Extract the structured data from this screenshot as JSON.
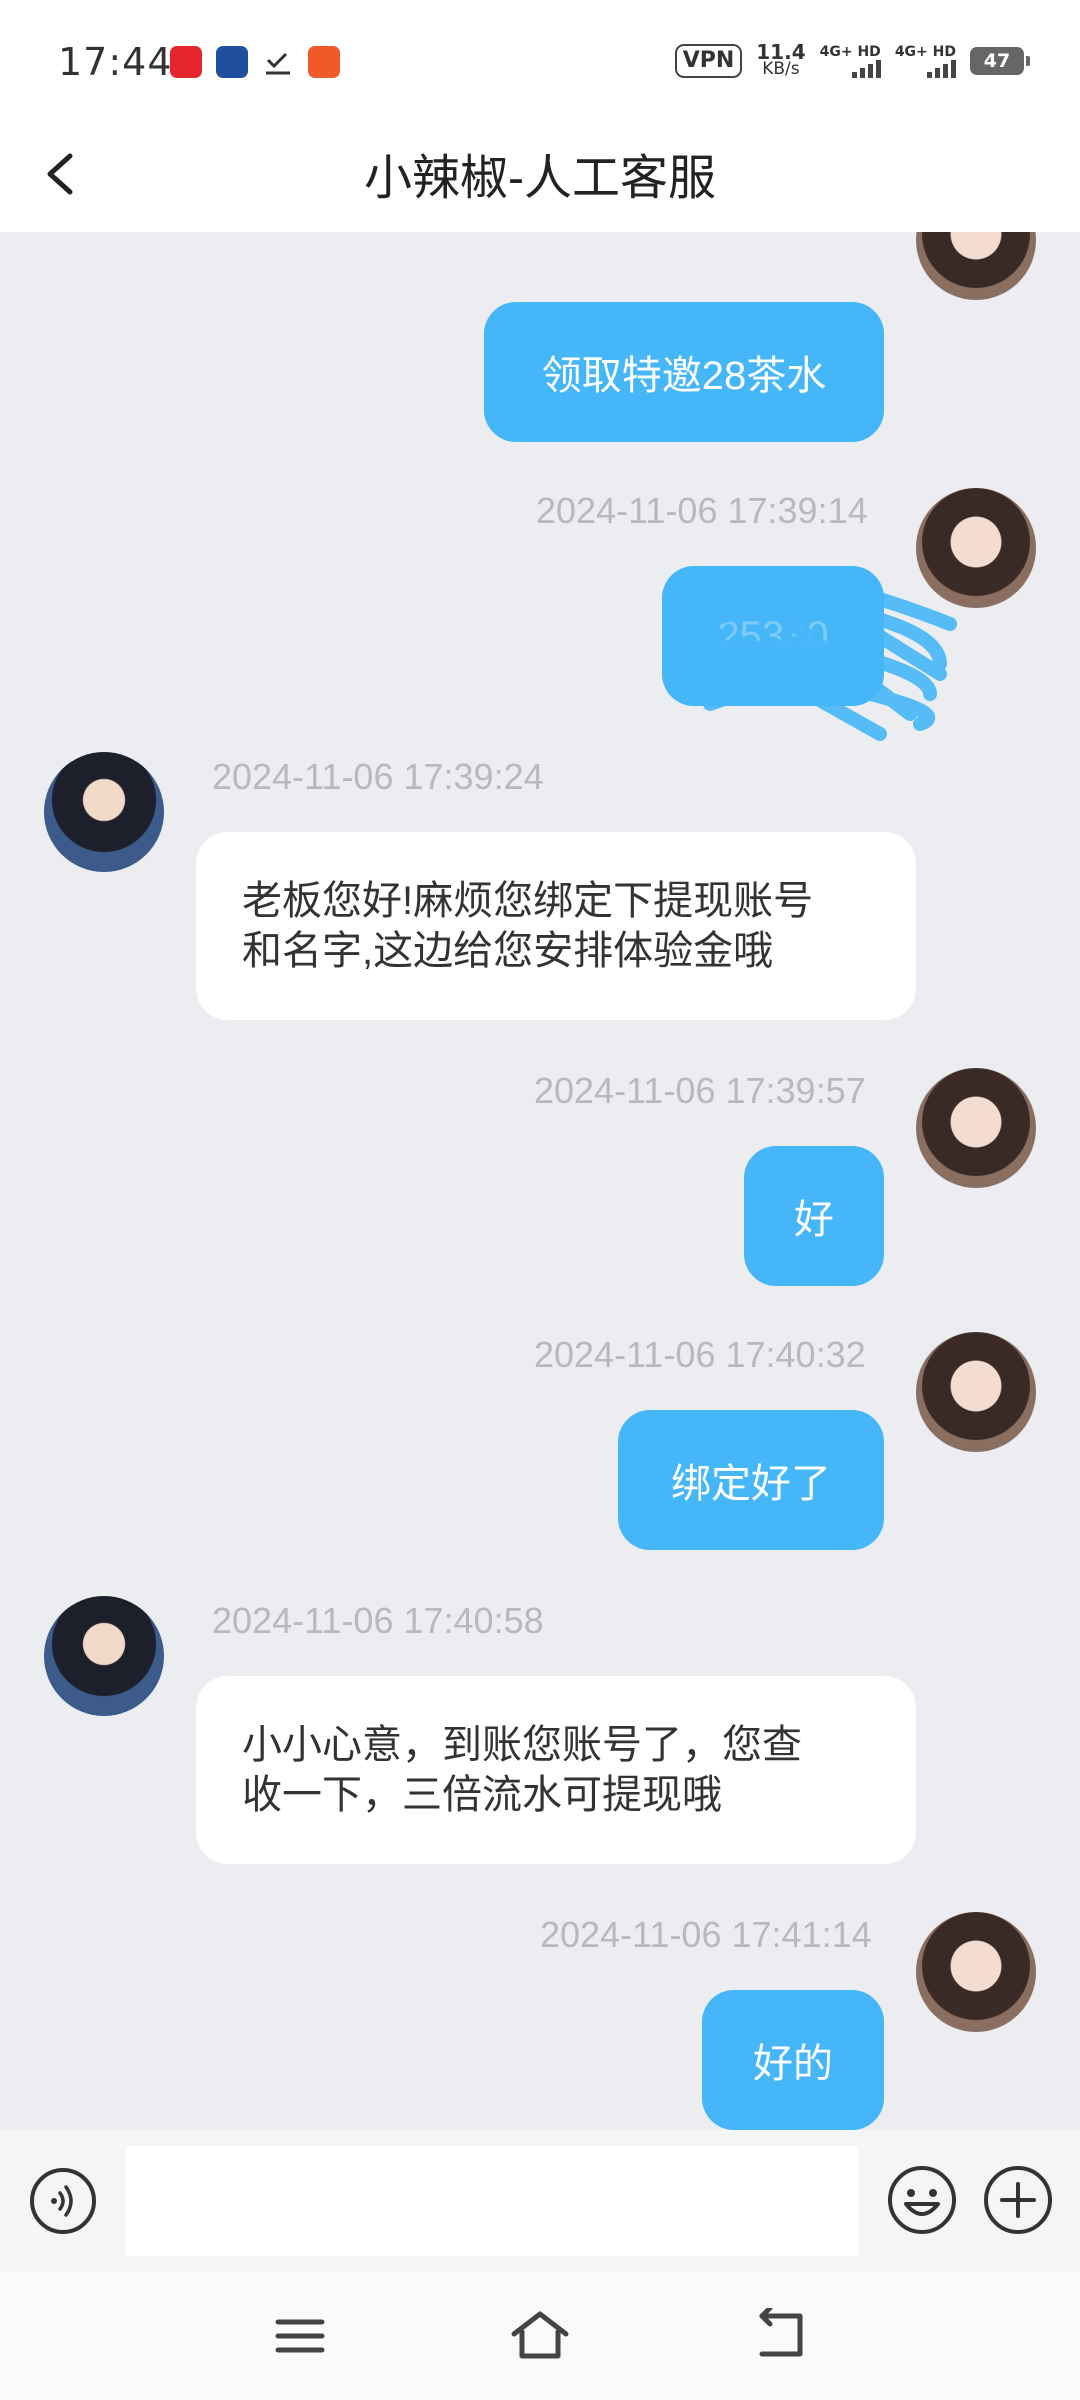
{
  "status_bar": {
    "time": "17:44",
    "vpn": "VPN",
    "speed_value": "11.4",
    "speed_unit": "KB/s",
    "sim1": "4G+ HD",
    "sim2": "4G+ HD",
    "battery": "47"
  },
  "header": {
    "title": "小辣椒-人工客服"
  },
  "messages": [
    {
      "side": "out",
      "text": "领取特邀28茶水"
    },
    {
      "side": "out",
      "time": "2024-11-06 17:39:14",
      "text": "25330"
    },
    {
      "side": "in",
      "time": "2024-11-06 17:39:24",
      "text_line1": "老板您好!麻烦您绑定下提现账号",
      "text_line2": "和名字,这边给您安排体验金哦"
    },
    {
      "side": "out",
      "time": "2024-11-06 17:39:57",
      "text": "好"
    },
    {
      "side": "out",
      "time": "2024-11-06 17:40:32",
      "text": "绑定好了"
    },
    {
      "side": "in",
      "time": "2024-11-06 17:40:58",
      "text_line1": "小小心意，到账您账号了，您查",
      "text_line2": "收一下，三倍流水可提现哦"
    },
    {
      "side": "out",
      "time": "2024-11-06 17:41:14",
      "text": "好的"
    }
  ],
  "input": {
    "placeholder": ""
  },
  "colors": {
    "outgoing_bubble": "#45b6f7",
    "incoming_bubble": "#ffffff",
    "chat_background": "#ebedf0"
  }
}
